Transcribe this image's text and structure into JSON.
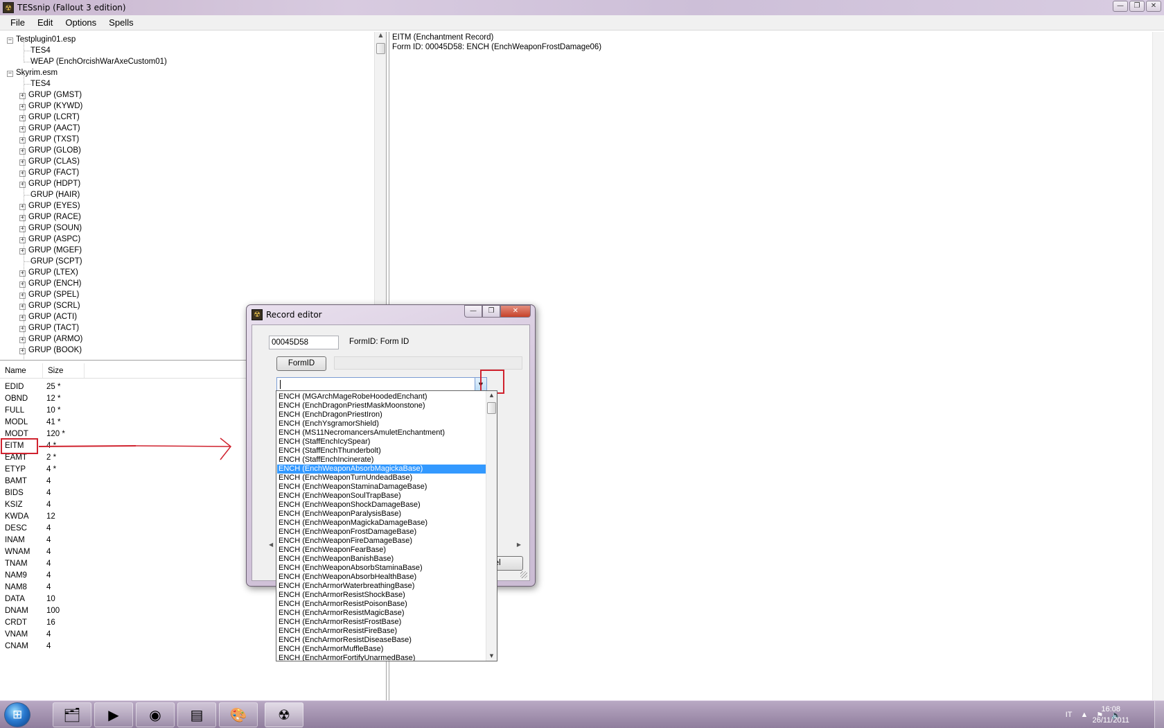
{
  "window": {
    "title": "TESsnip (Fallout 3 edition)",
    "min": "—",
    "max": "❐",
    "close": "✕"
  },
  "menu": [
    "File",
    "Edit",
    "Options",
    "Spells"
  ],
  "tree": [
    {
      "label": "Testplugin01.esp",
      "level": 0,
      "expand": "−"
    },
    {
      "label": "TES4",
      "level": 1,
      "expand": ""
    },
    {
      "label": "WEAP (EnchOrcishWarAxeCustom01)",
      "level": 1,
      "expand": ""
    },
    {
      "label": "Skyrim.esm",
      "level": 0,
      "expand": "−"
    },
    {
      "label": "TES4",
      "level": 1,
      "expand": ""
    },
    {
      "label": "GRUP (GMST)",
      "level": 1,
      "expand": "+"
    },
    {
      "label": "GRUP (KYWD)",
      "level": 1,
      "expand": "+"
    },
    {
      "label": "GRUP (LCRT)",
      "level": 1,
      "expand": "+"
    },
    {
      "label": "GRUP (AACT)",
      "level": 1,
      "expand": "+"
    },
    {
      "label": "GRUP (TXST)",
      "level": 1,
      "expand": "+"
    },
    {
      "label": "GRUP (GLOB)",
      "level": 1,
      "expand": "+"
    },
    {
      "label": "GRUP (CLAS)",
      "level": 1,
      "expand": "+"
    },
    {
      "label": "GRUP (FACT)",
      "level": 1,
      "expand": "+"
    },
    {
      "label": "GRUP (HDPT)",
      "level": 1,
      "expand": "+"
    },
    {
      "label": "GRUP (HAIR)",
      "level": 1,
      "expand": ""
    },
    {
      "label": "GRUP (EYES)",
      "level": 1,
      "expand": "+"
    },
    {
      "label": "GRUP (RACE)",
      "level": 1,
      "expand": "+"
    },
    {
      "label": "GRUP (SOUN)",
      "level": 1,
      "expand": "+"
    },
    {
      "label": "GRUP (ASPC)",
      "level": 1,
      "expand": "+"
    },
    {
      "label": "GRUP (MGEF)",
      "level": 1,
      "expand": "+"
    },
    {
      "label": "GRUP (SCPT)",
      "level": 1,
      "expand": ""
    },
    {
      "label": "GRUP (LTEX)",
      "level": 1,
      "expand": "+"
    },
    {
      "label": "GRUP (ENCH)",
      "level": 1,
      "expand": "+"
    },
    {
      "label": "GRUP (SPEL)",
      "level": 1,
      "expand": "+"
    },
    {
      "label": "GRUP (SCRL)",
      "level": 1,
      "expand": "+"
    },
    {
      "label": "GRUP (ACTI)",
      "level": 1,
      "expand": "+"
    },
    {
      "label": "GRUP (TACT)",
      "level": 1,
      "expand": "+"
    },
    {
      "label": "GRUP (ARMO)",
      "level": 1,
      "expand": "+"
    },
    {
      "label": "GRUP (BOOK)",
      "level": 1,
      "expand": "+"
    }
  ],
  "list": {
    "columns": [
      "Name",
      "Size"
    ],
    "rows": [
      {
        "name": "EDID",
        "size": "25 *"
      },
      {
        "name": "OBND",
        "size": "12 *"
      },
      {
        "name": "FULL",
        "size": "10 *"
      },
      {
        "name": "MODL",
        "size": "41 *"
      },
      {
        "name": "MODT",
        "size": "120 *"
      },
      {
        "name": "EITM",
        "size": "4 *"
      },
      {
        "name": "EAMT",
        "size": "2 *"
      },
      {
        "name": "ETYP",
        "size": "4 *"
      },
      {
        "name": "BAMT",
        "size": "4"
      },
      {
        "name": "BIDS",
        "size": "4"
      },
      {
        "name": "KSIZ",
        "size": "4"
      },
      {
        "name": "KWDA",
        "size": "12"
      },
      {
        "name": "DESC",
        "size": "4"
      },
      {
        "name": "INAM",
        "size": "4"
      },
      {
        "name": "WNAM",
        "size": "4"
      },
      {
        "name": "TNAM",
        "size": "4"
      },
      {
        "name": "NAM9",
        "size": "4"
      },
      {
        "name": "NAM8",
        "size": "4"
      },
      {
        "name": "DATA",
        "size": "10"
      },
      {
        "name": "DNAM",
        "size": "100"
      },
      {
        "name": "CRDT",
        "size": "16"
      },
      {
        "name": "VNAM",
        "size": "4"
      },
      {
        "name": "CNAM",
        "size": "4"
      }
    ]
  },
  "detail": {
    "line1": "EITM (Enchantment Record)",
    "line2": "Form ID: 00045D58: ENCH (EnchWeaponFrostDamage06)"
  },
  "dialog": {
    "title": "Record editor",
    "formid_value": "00045D58",
    "formid_label": "FormID: Form ID",
    "formid_button": "FormID",
    "combo_value": "",
    "cancel_partial": "cel",
    "items": [
      "ENCH (MGArchMageRobeHoodedEnchant)",
      "ENCH (EnchDragonPriestMaskMoonstone)",
      "ENCH (EnchDragonPriestIron)",
      "ENCH (EnchYsgramorShield)",
      "ENCH (MS11NecromancersAmuletEnchantment)",
      "ENCH (StaffEnchIcySpear)",
      "ENCH (StaffEnchThunderbolt)",
      "ENCH (StaffEnchIncinerate)",
      "ENCH (EnchWeaponAbsorbMagickaBase)",
      "ENCH (EnchWeaponTurnUndeadBase)",
      "ENCH (EnchWeaponStaminaDamageBase)",
      "ENCH (EnchWeaponSoulTrapBase)",
      "ENCH (EnchWeaponShockDamageBase)",
      "ENCH (EnchWeaponParalysisBase)",
      "ENCH (EnchWeaponMagickaDamageBase)",
      "ENCH (EnchWeaponFrostDamageBase)",
      "ENCH (EnchWeaponFireDamageBase)",
      "ENCH (EnchWeaponFearBase)",
      "ENCH (EnchWeaponBanishBase)",
      "ENCH (EnchWeaponAbsorbStaminaBase)",
      "ENCH (EnchWeaponAbsorbHealthBase)",
      "ENCH (EnchArmorWaterbreathingBase)",
      "ENCH (EnchArmorResistShockBase)",
      "ENCH (EnchArmorResistPoisonBase)",
      "ENCH (EnchArmorResistMagicBase)",
      "ENCH (EnchArmorResistFrostBase)",
      "ENCH (EnchArmorResistFireBase)",
      "ENCH (EnchArmorResistDiseaseBase)",
      "ENCH (EnchArmorMuffleBase)",
      "ENCH (EnchArmorFortifyUnarmedBase)"
    ],
    "selected_index": 8
  },
  "taskbar": {
    "apps": [
      "file-explorer",
      "media-player",
      "chrome",
      "document-viewer",
      "paint",
      "tessnip"
    ],
    "language": "IT",
    "time": "16:08",
    "date": "26/11/2011"
  },
  "colors": {
    "highlight_red": "#d0222e",
    "selection_blue": "#3399ff"
  }
}
